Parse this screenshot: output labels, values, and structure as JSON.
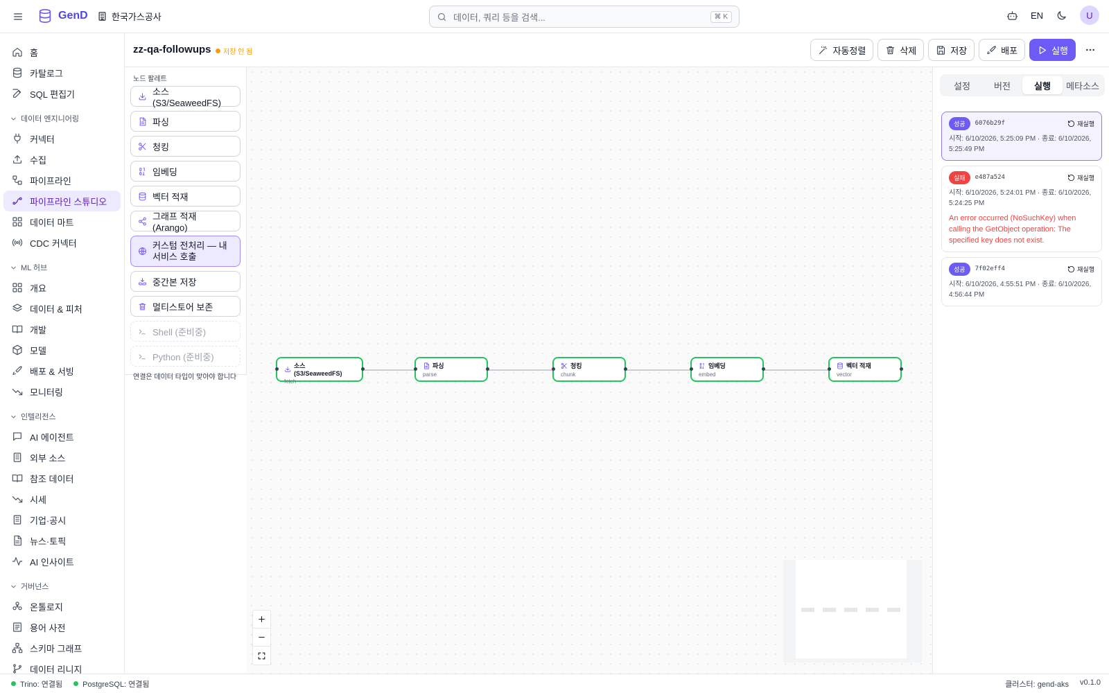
{
  "app": {
    "name": "GenD",
    "org": "한국가스공사"
  },
  "search": {
    "placeholder": "데이터, 쿼리 등을 검색...",
    "shortcut": "⌘ K"
  },
  "topbar": {
    "lang": "EN",
    "avatar": "U"
  },
  "sidebar": {
    "items": [
      {
        "label": "홈",
        "icon": "home-icon"
      },
      {
        "label": "카탈로그",
        "icon": "database-icon"
      },
      {
        "label": "SQL 편집기",
        "icon": "edit-icon"
      }
    ],
    "sections": [
      {
        "title": "데이터 엔지니어링",
        "items": [
          {
            "label": "커넥터",
            "icon": "plug-icon"
          },
          {
            "label": "수집",
            "icon": "upload-icon"
          },
          {
            "label": "파이프라인",
            "icon": "workflow-icon"
          },
          {
            "label": "파이프라인 스튜디오",
            "icon": "flow-icon",
            "active": true
          },
          {
            "label": "데이터 마트",
            "icon": "grid-icon"
          },
          {
            "label": "CDC 커넥터",
            "icon": "radio-icon"
          }
        ]
      },
      {
        "title": "ML 허브",
        "items": [
          {
            "label": "개요",
            "icon": "grid-icon"
          },
          {
            "label": "데이터 & 피처",
            "icon": "layers-icon"
          },
          {
            "label": "개발",
            "icon": "book-icon"
          },
          {
            "label": "모델",
            "icon": "box-icon"
          },
          {
            "label": "배포 & 서빙",
            "icon": "rocket-icon"
          },
          {
            "label": "모니터링",
            "icon": "trend-icon"
          }
        ]
      },
      {
        "title": "인텔리전스",
        "items": [
          {
            "label": "AI 에이전트",
            "icon": "chat-icon"
          },
          {
            "label": "외부 소스",
            "icon": "building-icon"
          },
          {
            "label": "참조 데이터",
            "icon": "book-icon"
          },
          {
            "label": "시세",
            "icon": "trend-icon"
          },
          {
            "label": "기업·공시",
            "icon": "building-icon"
          },
          {
            "label": "뉴스·토픽",
            "icon": "file-icon"
          },
          {
            "label": "AI 인사이트",
            "icon": "activity-icon"
          }
        ]
      },
      {
        "title": "거버넌스",
        "items": [
          {
            "label": "온톨로지",
            "icon": "ontology-icon"
          },
          {
            "label": "용어 사전",
            "icon": "list-icon"
          },
          {
            "label": "스키마 그래프",
            "icon": "network-icon"
          },
          {
            "label": "데이터 리니지",
            "icon": "branch-icon"
          }
        ]
      }
    ]
  },
  "header": {
    "title": "zz-qa-followups",
    "status": "저장 안 됨",
    "buttons": {
      "auto_align": "자동정렬",
      "delete": "삭제",
      "save": "저장",
      "deploy": "배포",
      "run": "실행"
    }
  },
  "palette": {
    "title": "노드 팔레트",
    "items": [
      {
        "label": "소스 (S3/SeaweedFS)",
        "icon": "download-icon"
      },
      {
        "label": "파싱",
        "icon": "file-icon"
      },
      {
        "label": "청킹",
        "icon": "scissors-icon"
      },
      {
        "label": "임베딩",
        "icon": "binary-icon"
      },
      {
        "label": "벡터 적재",
        "icon": "database-icon"
      },
      {
        "label": "그래프 적재 (Arango)",
        "icon": "share-icon"
      },
      {
        "label": "커스텀 전처리 — 내 서비스 호출",
        "icon": "globe-icon",
        "selected": true
      },
      {
        "label": "중간본 저장",
        "icon": "save-tray-icon"
      },
      {
        "label": "멀티스토어 보존",
        "icon": "trash-icon"
      },
      {
        "label": "Shell (준비중)",
        "icon": "terminal-icon",
        "disabled": true
      },
      {
        "label": "Python (준비중)",
        "icon": "terminal-icon",
        "disabled": true
      }
    ],
    "note": "연결은 데이터 타입이 맞아야 합니다"
  },
  "canvas": {
    "nodes": [
      {
        "label": "소스 (S3/SeaweedFS)",
        "sub": "fetch",
        "icon": "download-icon"
      },
      {
        "label": "파싱",
        "sub": "parse",
        "icon": "file-icon"
      },
      {
        "label": "청킹",
        "sub": "chunk",
        "icon": "scissors-icon"
      },
      {
        "label": "임베딩",
        "sub": "embed",
        "icon": "binary-icon"
      },
      {
        "label": "벡터 적재",
        "sub": "vector",
        "icon": "database-icon"
      }
    ],
    "node_status_color": "#22c55e"
  },
  "rpanel": {
    "tabs": [
      {
        "label": "설정"
      },
      {
        "label": "버전"
      },
      {
        "label": "실행",
        "active": true
      },
      {
        "label": "메타소스"
      }
    ],
    "rerun_label": "재실행",
    "runs": [
      {
        "status": "성공",
        "kind": "ok",
        "id": "6076b29f",
        "time": "시작: 6/10/2026, 5:25:09 PM · 종료: 6/10/2026, 5:25:49 PM",
        "active": true
      },
      {
        "status": "실패",
        "kind": "fail",
        "id": "e487a524",
        "time": "시작: 6/10/2026, 5:24:01 PM · 종료: 6/10/2026, 5:24:25 PM",
        "error": "An error occurred (NoSuchKey) when calling the GetObject operation: The specified key does not exist."
      },
      {
        "status": "성공",
        "kind": "ok",
        "id": "7f02eff4",
        "time": "시작: 6/10/2026, 4:55:51 PM · 종료: 6/10/2026, 4:56:44 PM"
      }
    ]
  },
  "statusbar": {
    "trino": "Trino: 연결됨",
    "postgres": "PostgreSQL: 연결됨",
    "cluster": "클러스터: gend-aks",
    "version": "v0.1.0"
  },
  "colors": {
    "accent": "#6d5bf5",
    "success": "#22c55e",
    "error": "#ef4444",
    "warning": "#f59e0b"
  }
}
